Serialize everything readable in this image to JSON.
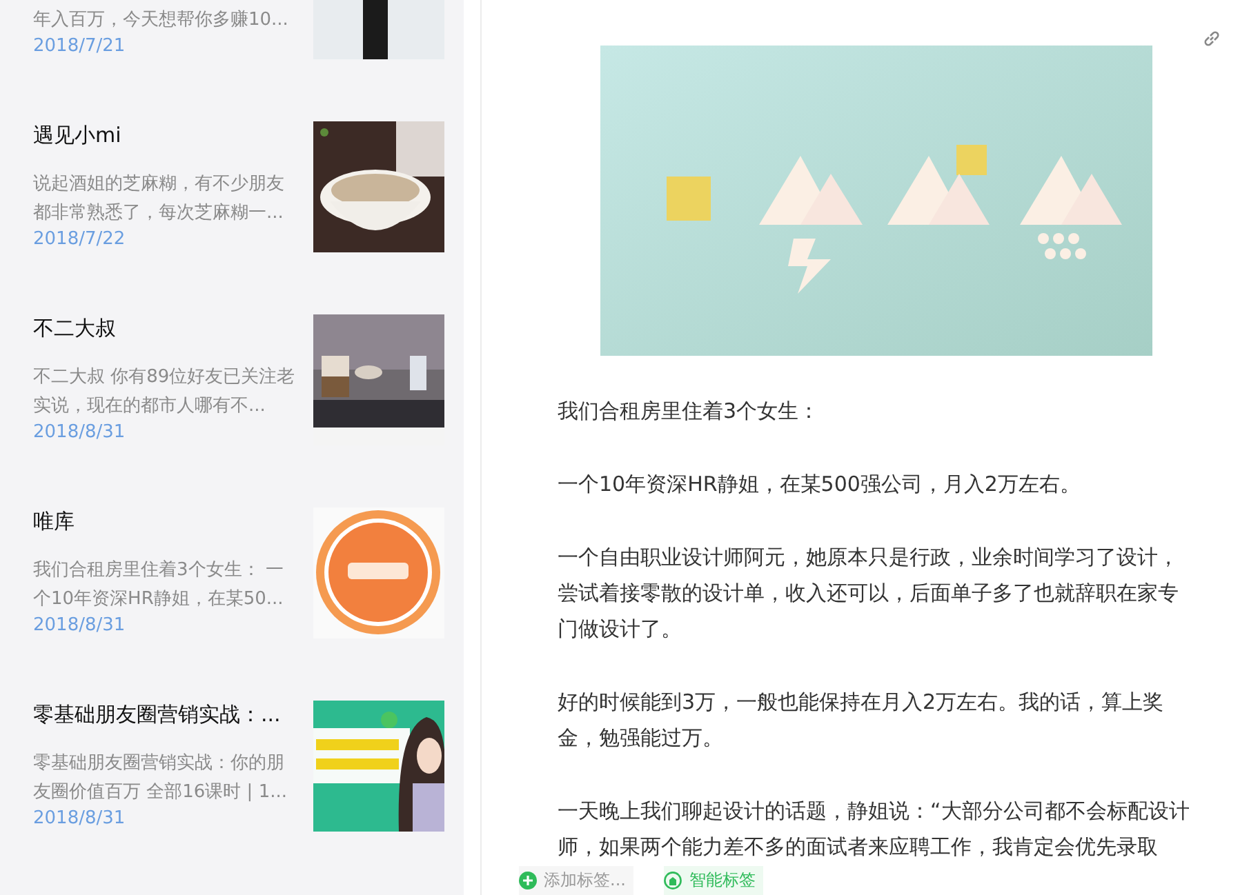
{
  "articles": [
    {
      "kind": "partial",
      "snippet": "年入百万，今天想帮你多赚10...",
      "date": "2018/7/21"
    },
    {
      "kind": "full",
      "title": "遇见小mi",
      "snippet": "说起酒姐的芝麻糊，有不少朋友都非常熟悉了，每次芝麻糊一...",
      "date": "2018/7/22"
    },
    {
      "kind": "full",
      "title": "不二大叔",
      "snippet": "不二大叔 你有89位好友已关注老实说，现在的都市人哪有不...",
      "date": "2018/8/31"
    },
    {
      "kind": "full",
      "title": "唯库",
      "snippet": "我们合租房里住着3个女生： 一个10年资深HR静姐，在某50...",
      "date": "2018/8/31"
    },
    {
      "kind": "full",
      "title": "零基础朋友圈营销实战：...",
      "snippet": "零基础朋友圈营销实战：你的朋友圈价值百万 全部16课时 | 1...",
      "date": "2018/8/31"
    }
  ],
  "article": {
    "paragraphs": [
      "我们合租房里住着3个女生：",
      "一个10年资深HR静姐，在某500强公司，月入2万左右。",
      "一个自由职业设计师阿元，她原本只是行政，业余时间学习了设计，尝试着接零散的设计单，收入还可以，后面单子多了也就辞职在家专门做设计了。",
      "好的时候能到3万，一般也能保持在月入2万左右。我的话，算上奖金，勉强能过万。",
      "一天晚上我们聊起设计的话题，静姐说：“大部分公司都不会标配设计师，如果两个能力差不多的面试者来应聘工作，我肯定会优先录取"
    ]
  },
  "toolbar": {
    "add_tag": "添加标签...",
    "smart_tag": "智能标签"
  }
}
